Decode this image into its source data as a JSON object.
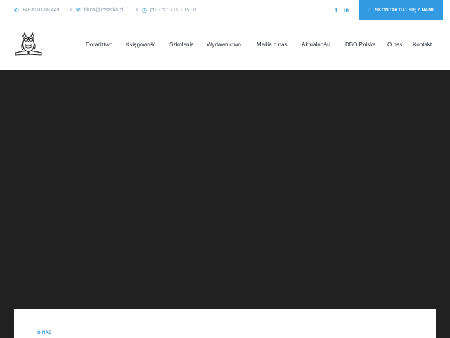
{
  "topbar": {
    "phone": "+48 600 088 449",
    "email": "biuro@kosacka.pl",
    "hours": "pn. - pt.: 7.00 - 15.00",
    "social": {
      "facebook": "f",
      "linkedin": "in"
    },
    "cta_label": "SKONTAKTUJ SIĘ Z NAMI",
    "icons": [
      "phone-icon",
      "mail-icon",
      "clock-icon",
      "facebook-icon",
      "linkedin-icon",
      "chat-icon"
    ]
  },
  "nav": {
    "items": [
      "Doradztwo",
      "Księgowość",
      "Szkolenia",
      "Wydawnictwo",
      "Media o nas",
      "Aktualności",
      "DBO Polska",
      "O nas",
      "Kontakt"
    ]
  },
  "card": {
    "label": "O NAS"
  },
  "colors": {
    "accent": "#3399e0",
    "hero_background": "#212121",
    "nav_text": "#1d2430",
    "muted_text": "#8a97a5"
  }
}
